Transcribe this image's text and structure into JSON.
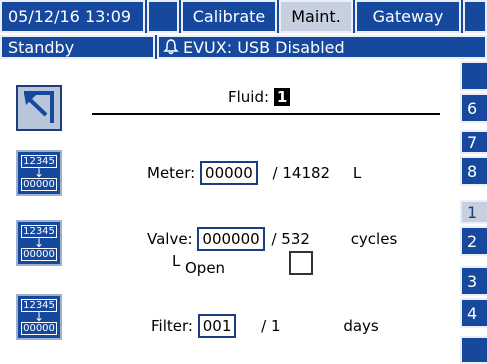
{
  "header": {
    "datetime": "05/12/16 13:09",
    "tabs": [
      {
        "label": "Calibrate"
      },
      {
        "label": "Maint."
      },
      {
        "label": "Gateway"
      }
    ],
    "status": "Standby",
    "alert_icon": "bell-icon",
    "alert_text": "EVUX: USB Disabled"
  },
  "main": {
    "fluid_label": "Fluid:",
    "fluid_value": "1",
    "meter": {
      "label": "Meter:",
      "value": "00000",
      "total": "/ 14182",
      "unit": "L"
    },
    "valve": {
      "label": "Valve:",
      "value": "000000",
      "total": "/ 532",
      "unit": "cycles",
      "sub_prefix": "L",
      "sub_label": "Open"
    },
    "filter": {
      "label": "Filter:",
      "value": "001",
      "total": "/ 1",
      "unit": "days"
    },
    "reset_icon_text_top": "12345",
    "reset_icon_text_bottom": "00000"
  },
  "side_tabs": [
    "",
    "6",
    "7",
    "8",
    "1",
    "2",
    "3",
    "4",
    ""
  ],
  "colors": {
    "accent": "#16499e",
    "selected": "#c7d0de"
  }
}
